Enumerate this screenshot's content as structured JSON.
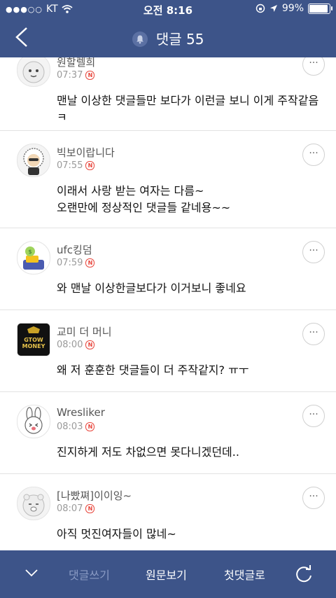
{
  "status_bar": {
    "carrier": "KT",
    "time": "오전 8:16",
    "battery": "99%"
  },
  "header": {
    "title": "댓글 55",
    "back_icon": "chevron-left-icon",
    "bell_icon": "bell-icon"
  },
  "comments": [
    {
      "author": "원할렐희",
      "time": "07:37",
      "badge": "N",
      "text": "맨날 이상한 댓글들만 보다가 이런글 보니 이게 주작같음ㅋ"
    },
    {
      "author": "빅보이랍니다",
      "time": "07:55",
      "badge": "N",
      "text_lines": [
        "이래서 사랑 받는 여자는 다름~",
        "오랜만에 정상적인 댓글들 같네용~~"
      ]
    },
    {
      "author": "ufc킹덤",
      "time": "07:59",
      "badge": "N",
      "text": "와 맨날 이상한글보다가 이거보니  좋네요"
    },
    {
      "author": "교미 더 머니",
      "time": "08:00",
      "badge": "N",
      "text": "왜 저 훈훈한 댓글들이 더 주작같지? ㅠㅜ",
      "avatar_text": [
        "GTOW",
        "MONEY"
      ]
    },
    {
      "author": "Wresliker",
      "time": "08:03",
      "badge": "N",
      "text": "진지하게 저도 차없으면 못다니겠던데.."
    },
    {
      "author": "[나빴쪄]이이잉~",
      "time": "08:07",
      "badge": "N",
      "text": "아직 멋진여자들이 많네~"
    }
  ],
  "more_label": "···",
  "bottom_bar": {
    "write": "댓글쓰기",
    "original": "원문보기",
    "first": "첫댓글로",
    "collapse_icon": "chevron-down-icon",
    "refresh_icon": "refresh-icon"
  },
  "colors": {
    "header_bg": "#3d5489",
    "new_badge": "#e8463c"
  }
}
